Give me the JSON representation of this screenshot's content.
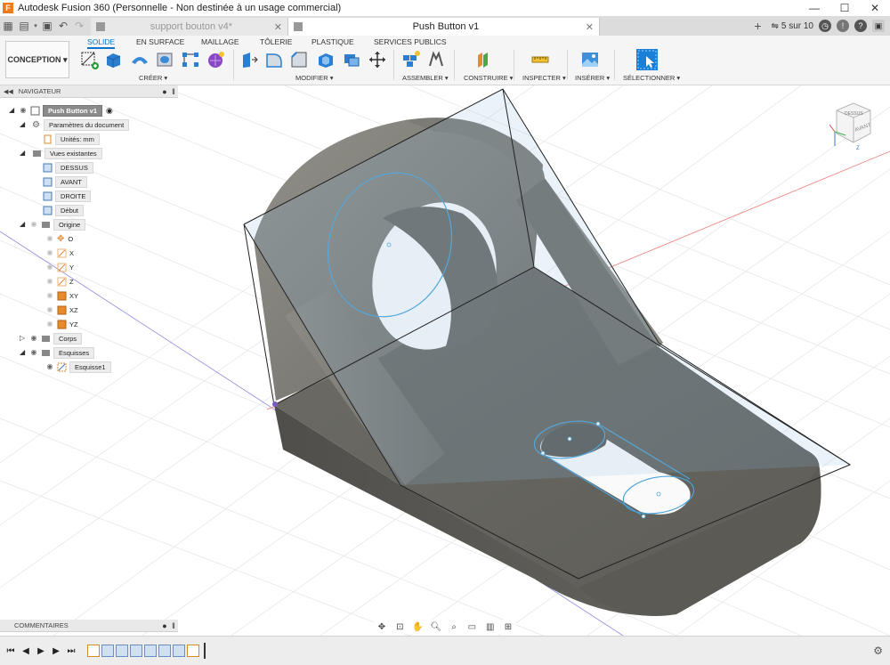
{
  "window": {
    "title": "Autodesk Fusion 360 (Personnelle - Non destinée à un usage commercial)",
    "minimize": "—",
    "maximize": "☐",
    "close": "✕"
  },
  "tabs": [
    {
      "label": "support bouton v4*",
      "active": false
    },
    {
      "label": "Push Button v1",
      "active": true
    }
  ],
  "tabbar": {
    "new_tab": "+",
    "job_status": "5 sur 10"
  },
  "toolbar": {
    "workspace": "CONCEPTION ▾",
    "workspace_tabs": [
      "SOLIDE",
      "EN SURFACE",
      "MAILLAGE",
      "TÔLERIE",
      "PLASTIQUE",
      "SERVICES PUBLICS"
    ],
    "groups": [
      "CRÉER ▾",
      "MODIFIER ▾",
      "ASSEMBLER ▾",
      "CONSTRUIRE ▾",
      "INSPECTER ▾",
      "INSÉRER ▾",
      "SÉLECTIONNER ▾"
    ]
  },
  "navigator": {
    "header": "NAVIGATEUR",
    "root": "Push Button v1",
    "doc_settings": "Paramètres du document",
    "units": "Unités: mm",
    "named_views": "Vues existantes",
    "views": [
      "DESSUS",
      "AVANT",
      "DROITE",
      "Début"
    ],
    "origin": "Origine",
    "origin_items": [
      "O",
      "X",
      "Y",
      "Z",
      "XY",
      "XZ",
      "YZ"
    ],
    "bodies": "Corps",
    "sketches": "Esquisses",
    "sketch1": "Esquisse1"
  },
  "comments": {
    "header": "COMMENTAIRES"
  },
  "viewcube": {
    "top": "DESSUS",
    "front": "AVANT",
    "axis_z": "Z",
    "axis_x": "X"
  },
  "colors": {
    "accent": "#0a74c9",
    "body_gray": "#6e6d66",
    "sketch_blue": "#4ba3d9"
  }
}
